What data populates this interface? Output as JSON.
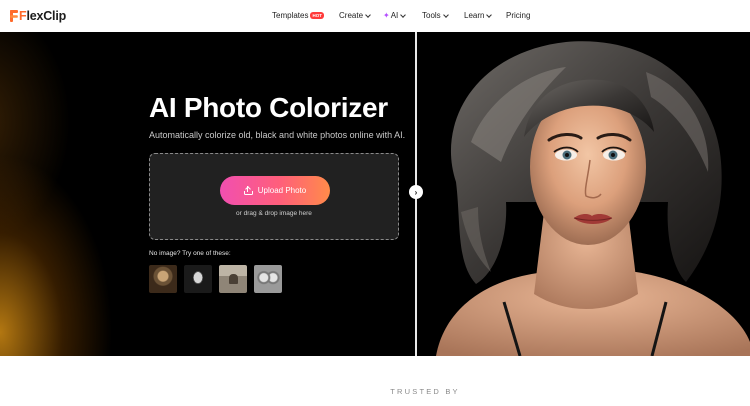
{
  "brand": {
    "name_first": "F",
    "name_rest": "lexClip",
    "accent": "#ff6a2b"
  },
  "nav": {
    "templates": "Templates",
    "hot_badge": "HOT",
    "create": "Create",
    "ai": "AI",
    "tools": "Tools",
    "learn": "Learn",
    "pricing": "Pricing"
  },
  "hero": {
    "title": "AI Photo Colorizer",
    "subtitle": "Automatically colorize old, black and white photos online with AI.",
    "upload_button": "Upload Photo",
    "drag_text": "or drag & drop image here",
    "try_label": "No image? Try one of these:",
    "samples": [
      "sample-1",
      "sample-2",
      "sample-3",
      "sample-4"
    ],
    "button_gradient": [
      "#f14fb0",
      "#ff5f7a",
      "#ff8b4a"
    ]
  },
  "footer": {
    "trusted_by": "TRUSTED BY"
  },
  "icons": {
    "logo": "flexclip-logo-icon",
    "upload": "upload-icon",
    "compare": "chevron-right-icon",
    "ai": "sparkle-icon"
  }
}
